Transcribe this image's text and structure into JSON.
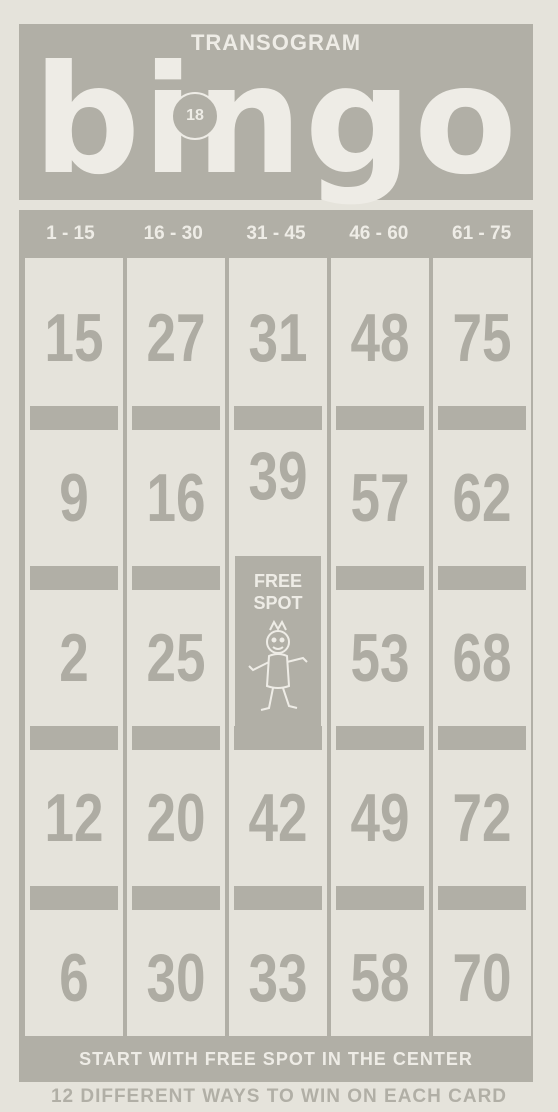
{
  "brand": "TRANSOGRAM",
  "logo": "bingo",
  "badge": "18",
  "ranges": [
    "1 - 15",
    "16 - 30",
    "31 - 45",
    "46 - 60",
    "61 - 75"
  ],
  "columns": [
    [
      "15",
      "9",
      "2",
      "12",
      "6"
    ],
    [
      "27",
      "16",
      "25",
      "20",
      "30"
    ],
    [
      "31",
      "39",
      "",
      "42",
      "33"
    ],
    [
      "48",
      "57",
      "53",
      "49",
      "58"
    ],
    [
      "75",
      "62",
      "68",
      "72",
      "70"
    ]
  ],
  "free_spot": "FREE SPOT",
  "footer": "START WITH FREE SPOT IN THE CENTER",
  "tagline": "12 DIFFERENT WAYS TO WIN ON EACH CARD"
}
